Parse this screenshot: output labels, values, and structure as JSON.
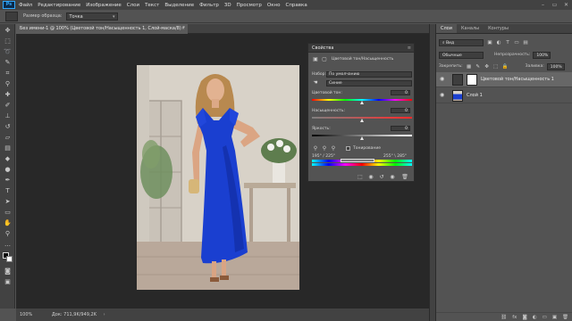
{
  "app": {
    "logo": "Ps"
  },
  "menu": [
    "Файл",
    "Редактирование",
    "Изображение",
    "Слои",
    "Текст",
    "Выделение",
    "Фильтр",
    "3D",
    "Просмотр",
    "Окно",
    "Справка"
  ],
  "options": {
    "sample_label": "Размер образца:",
    "sample_value": "Точка"
  },
  "document": {
    "tab_title": "Без имени-1 @ 100% (Цветовой тон/Насыщенность 1, Слой-маска/8) *",
    "zoom": "100%",
    "doc_info": "Док: 711,9K/949,2K"
  },
  "properties": {
    "title": "Свойства",
    "adjustment_name": "Цветовой тон/Насыщенность",
    "preset_label": "Набор:",
    "preset_value": "По умолчанию",
    "channel_value": "Синие",
    "hue_label": "Цветовой тон:",
    "hue_value": "0",
    "hue_position": 0.5,
    "saturation_label": "Насыщенность:",
    "saturation_value": "0",
    "saturation_position": 0.5,
    "lightness_label": "Яркость:",
    "lightness_value": "0",
    "lightness_position": 0.5,
    "colorize_label": "Тонирование",
    "range_left": "195° / 225°",
    "range_right": "255° \\ 285°"
  },
  "layers_panel": {
    "tabs": [
      "Слои",
      "Каналы",
      "Контуры"
    ],
    "filter_label": "Вид",
    "blend_mode": "Обычные",
    "opacity_label": "Непрозрачность:",
    "opacity_value": "100%",
    "lock_label": "Закрепить:",
    "fill_label": "Заливка:",
    "fill_value": "100%",
    "layers": [
      {
        "name": "Цветовой тон/Насыщенность 1",
        "selected": true
      },
      {
        "name": "Слой 1",
        "selected": false
      }
    ]
  },
  "colors": {
    "accent": "#31a8ff",
    "dress": "#1a3fd0"
  }
}
